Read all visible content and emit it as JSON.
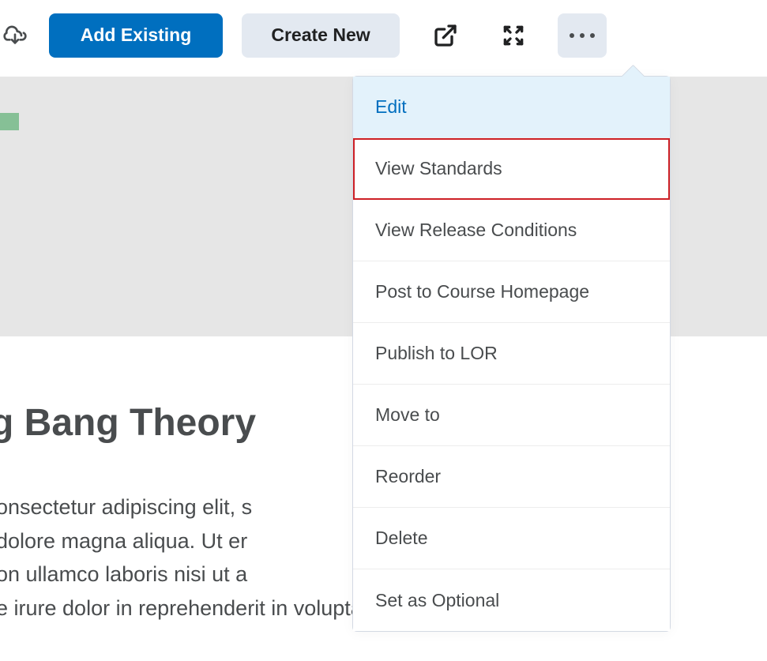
{
  "toolbar": {
    "add_existing_label": "Add Existing",
    "create_new_label": "Create New"
  },
  "content": {
    "title": "g Bang Theory",
    "line1": "onsectetur adipiscing elit, s",
    "line2": "dolore magna aliqua. Ut er",
    "line3": "on ullamco laboris nisi ut a",
    "line4": "e irure dolor in reprehenderit in voluptate"
  },
  "menu": {
    "items": [
      "Edit",
      "View Standards",
      "View Release Conditions",
      "Post to Course Homepage",
      "Publish to LOR",
      "Move to",
      "Reorder",
      "Delete",
      "Set as Optional"
    ]
  }
}
